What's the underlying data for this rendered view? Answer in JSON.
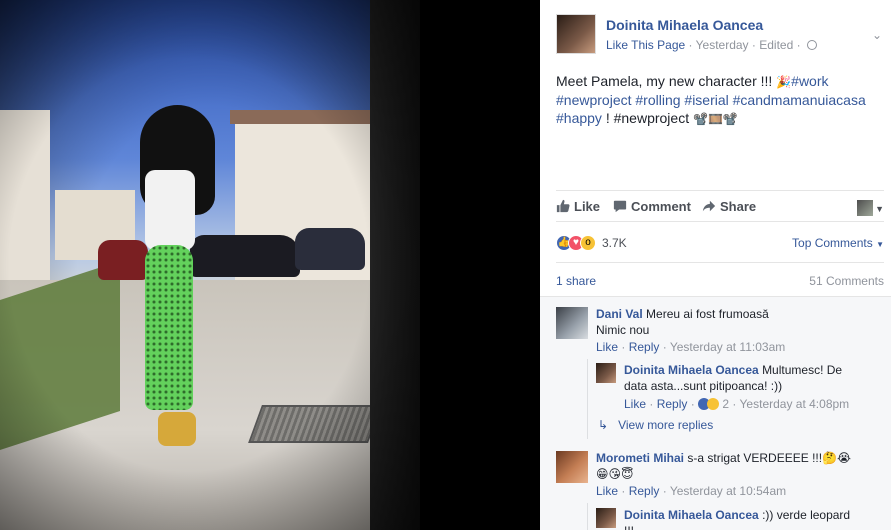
{
  "post": {
    "author": "Doinita Mihaela Oancea",
    "meta_like_page": "Like This Page",
    "meta_sep": " · ",
    "meta_time": "Yesterday",
    "meta_edited": "Edited",
    "text_intro": "Meet Pamela, my new character !!! ",
    "tags_line1": "#work",
    "tags_line2": "#newproject #rolling #iserial #candmamanuiacasa",
    "tag_happy": "#happy",
    "tail": " ! #newproject ",
    "emoji_party": "🎉",
    "emoji_film": "📽️🎞️📽️"
  },
  "actions": {
    "like": "Like",
    "comment": "Comment",
    "share": "Share"
  },
  "reactions": {
    "count": "3.7K",
    "top_comments": "Top Comments"
  },
  "stats": {
    "shares": "1 share",
    "comments": "51 Comments"
  },
  "comments": [
    {
      "name": "Dani Val",
      "text_line1": "Mereu ai fost frumoasă",
      "text_line2": "Nimic nou",
      "like": "Like",
      "reply": "Reply",
      "time": "Yesterday at 11:03am"
    },
    {
      "name": "Doinita Mihaela Oancea",
      "text_line1": "Multumesc! De",
      "text_line2": "data asta...sunt pitipoanca! :))",
      "like": "Like",
      "reply": "Reply",
      "reaction_count": "2",
      "time": "Yesterday at 4:08pm"
    },
    {
      "name": "Morometi Mihai",
      "text_line1": "s-a strigat VERDEEEE !!!",
      "emoji_line1": "🤔😭",
      "emoji_line2": "😁😘😇",
      "like": "Like",
      "reply": "Reply",
      "time": "Yesterday at 10:54am"
    },
    {
      "name": "Doinita Mihaela Oancea",
      "text_line1": ":)) verde leopard",
      "text_line2": "!!!"
    }
  ],
  "view_more_replies": "View more replies",
  "colors": {
    "link": "#365899",
    "meta": "#90949c",
    "like_blue": "#4267b2",
    "love_red": "#f25268",
    "wow_yellow": "#f7c235"
  }
}
